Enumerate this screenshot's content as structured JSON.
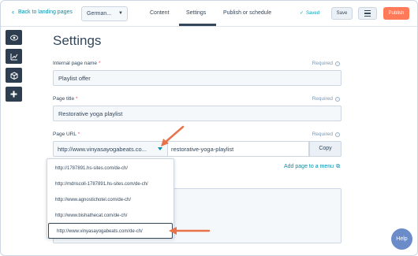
{
  "topbar": {
    "back_label": "Back to landing pages",
    "language": "German...",
    "tabs": [
      "Content",
      "Settings",
      "Publish or schedule"
    ],
    "saved_label": "Saved",
    "save_label": "Save",
    "publish_label": "Publish"
  },
  "rail": {
    "icons": [
      "eye-icon",
      "chart-icon",
      "cube-icon",
      "plus-icon"
    ]
  },
  "main": {
    "title": "Settings",
    "required_label": "Required",
    "internal_name": {
      "label": "Internal page name",
      "value": "Playlist offer"
    },
    "page_title": {
      "label": "Page title",
      "value": "Restorative yoga playlist"
    },
    "page_url": {
      "label": "Page URL",
      "domain": "http://www.vinyasayogabeats.co...",
      "slug": "restorative-yoga-playlist",
      "copy_label": "Copy"
    },
    "add_menu_label": "Add page to a menu"
  },
  "dropdown": {
    "options": [
      "http://1787891.hs-sites.com/de-ch/",
      "http://mdriscoll-1787891.hs-sites.com/de-ch/",
      "http://www.agnostichotel.com/de-ch/",
      "http://www.bishathecat.com/de-ch/",
      "http://www.vinyasayogabeats.com/de-ch/"
    ],
    "selected_index": 4
  },
  "help_label": "Help",
  "colors": {
    "accent": "#0091ae",
    "publish": "#ff7a59",
    "arrow": "#e8734a",
    "rail": "#2d3e50"
  }
}
